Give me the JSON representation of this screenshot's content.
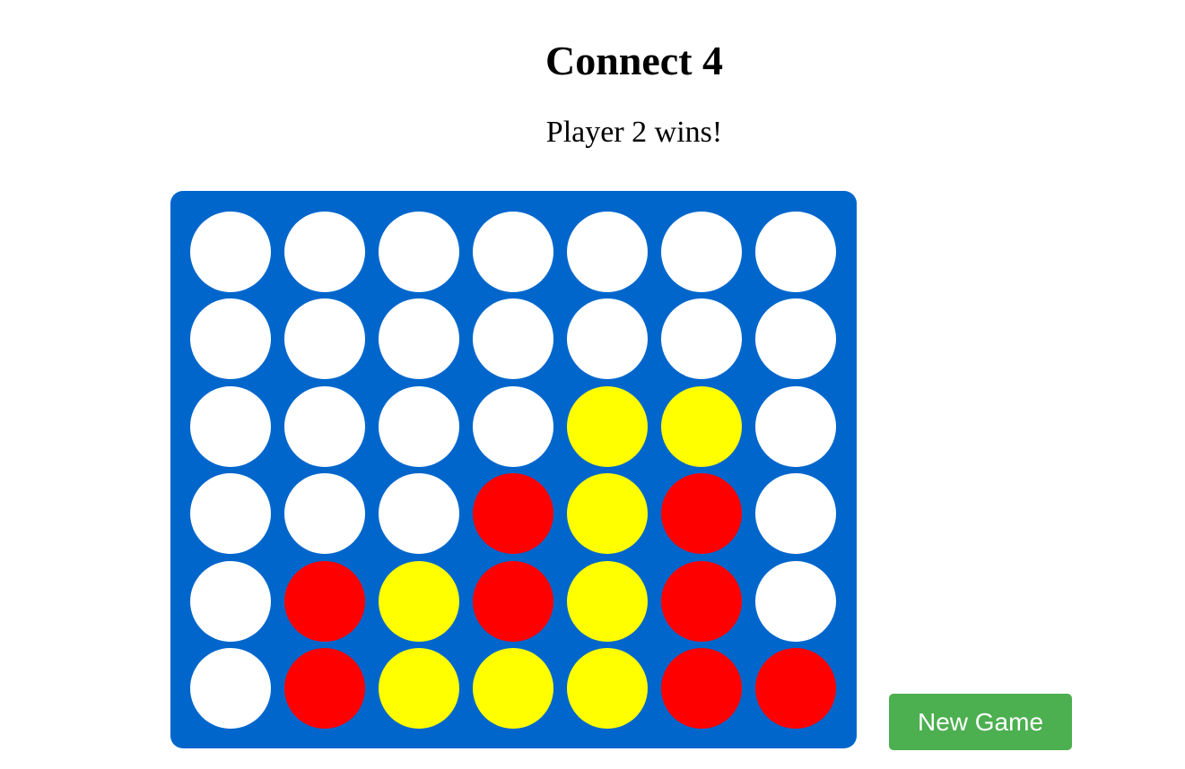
{
  "title": "Connect 4",
  "status": "Player 2 wins!",
  "new_game_label": "New Game",
  "colors": {
    "board": "#0066CC",
    "empty": "#FFFFFF",
    "player1": "#FF0000",
    "player2": "#FFFF00",
    "button": "#4CAF50"
  },
  "board": {
    "rows": 6,
    "cols": 7,
    "cells": [
      [
        "empty",
        "empty",
        "empty",
        "empty",
        "empty",
        "empty",
        "empty"
      ],
      [
        "empty",
        "empty",
        "empty",
        "empty",
        "empty",
        "empty",
        "empty"
      ],
      [
        "empty",
        "empty",
        "empty",
        "empty",
        "player2",
        "player2",
        "empty"
      ],
      [
        "empty",
        "empty",
        "empty",
        "player1",
        "player2",
        "player1",
        "empty"
      ],
      [
        "empty",
        "player1",
        "player2",
        "player1",
        "player2",
        "player1",
        "empty"
      ],
      [
        "empty",
        "player1",
        "player2",
        "player2",
        "player2",
        "player1",
        "player1"
      ]
    ]
  }
}
